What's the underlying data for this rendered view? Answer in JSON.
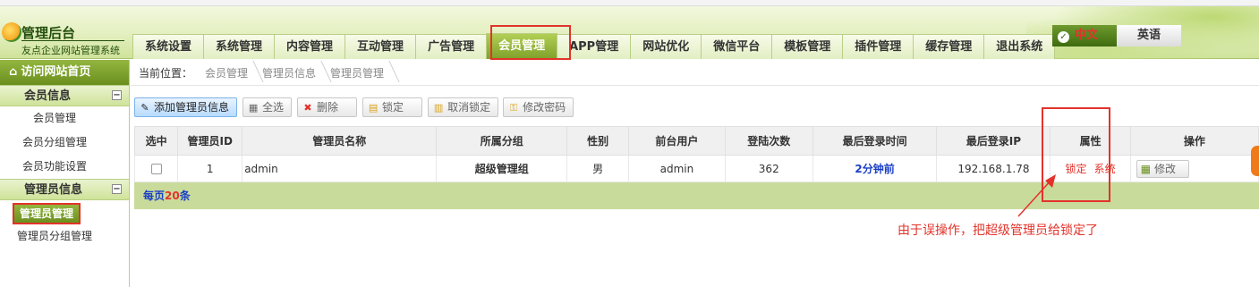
{
  "header": {
    "title": "管理后台",
    "subtitle": "友点企业网站管理系统"
  },
  "nav": {
    "items": [
      "系统设置",
      "系统管理",
      "内容管理",
      "互动管理",
      "广告管理",
      "会员管理",
      "APP管理",
      "网站优化",
      "微信平台",
      "模板管理",
      "插件管理",
      "缓存管理",
      "退出系统"
    ],
    "active": "会员管理"
  },
  "lang": {
    "cn": "中文",
    "en": "英语"
  },
  "sidebar": {
    "home": "访问网站首页",
    "sections": [
      {
        "title": "会员信息",
        "items": [
          "会员管理",
          "会员分组管理",
          "会员功能设置"
        ]
      },
      {
        "title": "管理员信息",
        "items": [
          "管理员管理",
          "管理员分组管理"
        ],
        "selected": "管理员管理"
      }
    ]
  },
  "breadcrumb": {
    "label": "当前位置：",
    "items": [
      "会员管理",
      "管理员信息",
      "管理员管理"
    ]
  },
  "toolbar": {
    "add": "添加管理员信息",
    "select_all": "全选",
    "delete": "删除",
    "lock": "锁定",
    "unlock": "取消锁定",
    "change_password": "修改密码"
  },
  "table": {
    "headers": [
      "选中",
      "管理员ID",
      "管理员名称",
      "所属分组",
      "性别",
      "前台用户",
      "登陆次数",
      "最后登录时间",
      "最后登录IP",
      "属性",
      "操作"
    ],
    "rows": [
      {
        "id": "1",
        "name": "admin",
        "group": "超级管理组",
        "gender": "男",
        "front_user": "admin",
        "login_count": "362",
        "last_login": "2分钟前",
        "last_ip": "192.168.1.78",
        "attr_lock": "锁定",
        "attr_system": "系统",
        "action": "修改"
      }
    ]
  },
  "pager": {
    "prefix": "每页",
    "count": "20",
    "suffix": "条"
  },
  "annotation": {
    "text": "由于误操作，把超级管理员给锁定了"
  },
  "colors": {
    "accent_green": "#7fa02a",
    "annotation_red": "#e2332b",
    "link_blue": "#1a3fc7"
  }
}
